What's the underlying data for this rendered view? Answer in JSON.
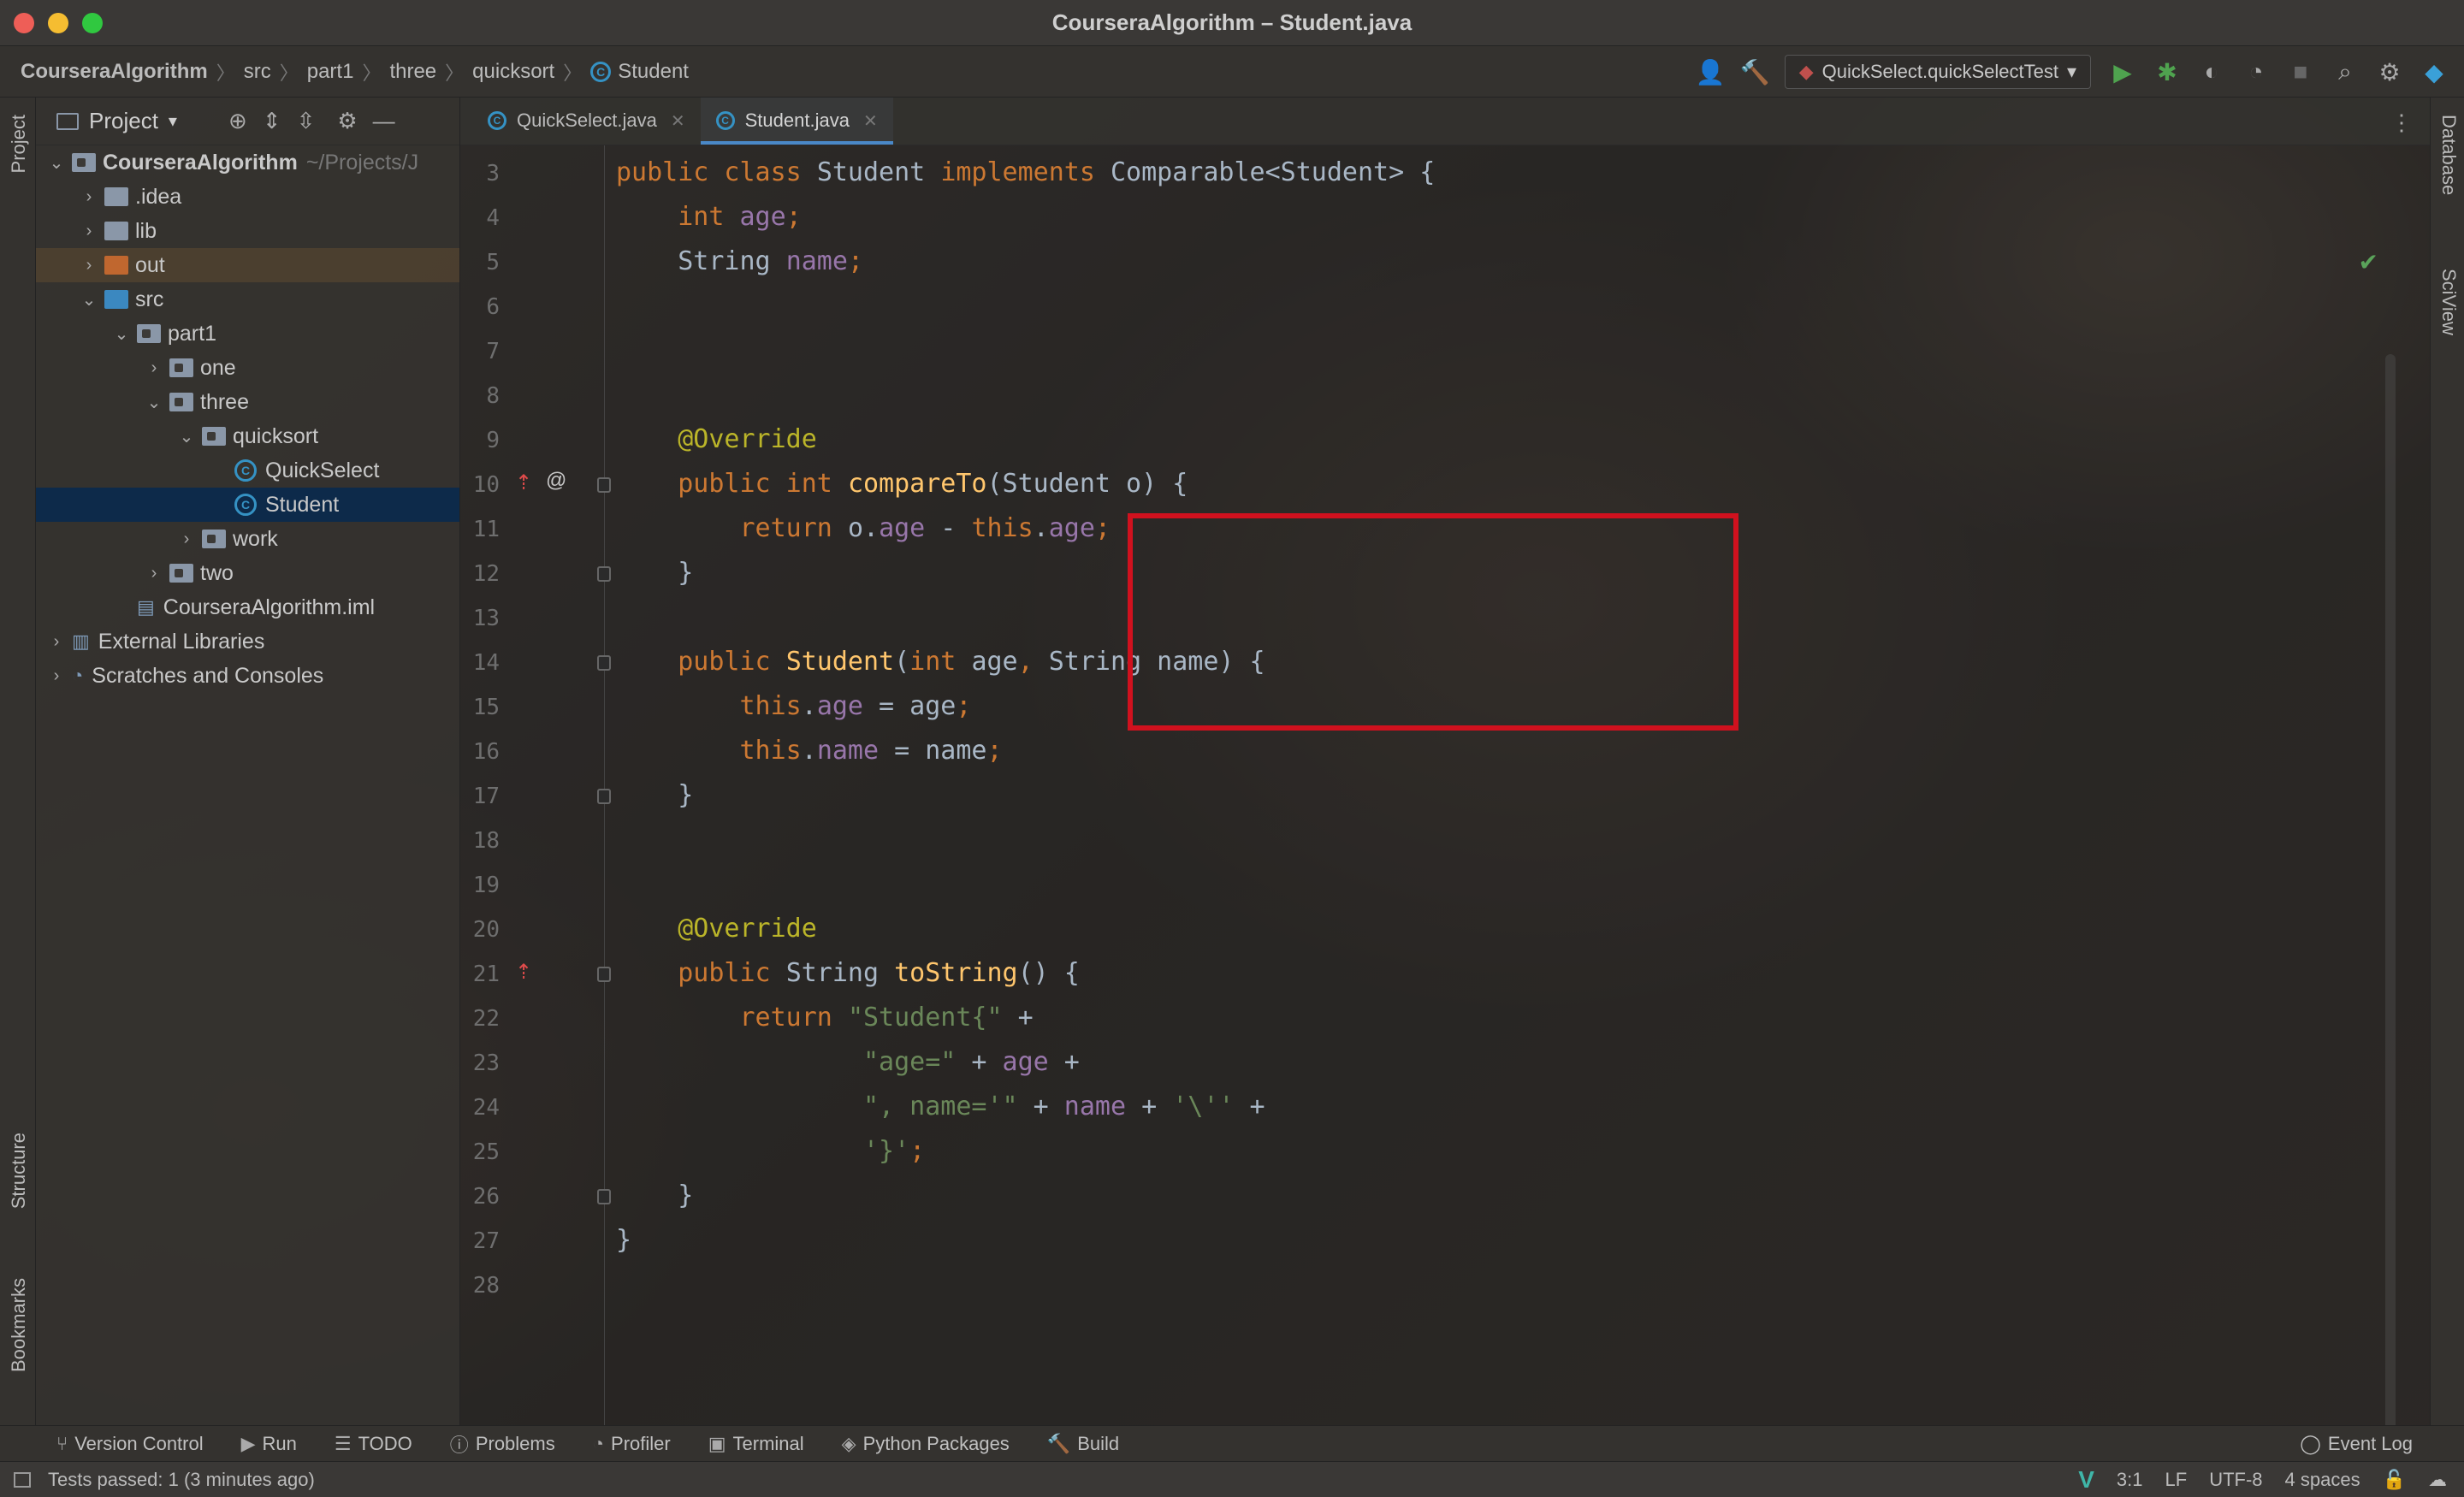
{
  "window": {
    "title": "CourseraAlgorithm – Student.java"
  },
  "breadcrumb": [
    "CourseraAlgorithm",
    "src",
    "part1",
    "three",
    "quicksort",
    "Student"
  ],
  "run_config": "QuickSelect.quickSelectTest",
  "project_panel": {
    "title": "Project",
    "tree": [
      {
        "label": "CourseraAlgorithm",
        "hint": "~/Projects/J",
        "indent": 0,
        "arrow": "down",
        "type": "module"
      },
      {
        "label": ".idea",
        "indent": 1,
        "arrow": "right",
        "type": "folder"
      },
      {
        "label": "lib",
        "indent": 1,
        "arrow": "right",
        "type": "folder"
      },
      {
        "label": "out",
        "indent": 1,
        "arrow": "right",
        "type": "folder-orange"
      },
      {
        "label": "src",
        "indent": 1,
        "arrow": "down",
        "type": "folder-blue"
      },
      {
        "label": "part1",
        "indent": 2,
        "arrow": "down",
        "type": "package"
      },
      {
        "label": "one",
        "indent": 3,
        "arrow": "right",
        "type": "package"
      },
      {
        "label": "three",
        "indent": 3,
        "arrow": "down",
        "type": "package"
      },
      {
        "label": "quicksort",
        "indent": 4,
        "arrow": "down",
        "type": "package"
      },
      {
        "label": "QuickSelect",
        "indent": 5,
        "arrow": "",
        "type": "class-runnable"
      },
      {
        "label": "Student",
        "indent": 5,
        "arrow": "",
        "type": "class",
        "selected": true
      },
      {
        "label": "work",
        "indent": 4,
        "arrow": "right",
        "type": "package"
      },
      {
        "label": "two",
        "indent": 3,
        "arrow": "right",
        "type": "package"
      },
      {
        "label": "CourseraAlgorithm.iml",
        "indent": 2,
        "arrow": "",
        "type": "iml"
      },
      {
        "label": "External Libraries",
        "indent": 0,
        "arrow": "right",
        "type": "libs"
      },
      {
        "label": "Scratches and Consoles",
        "indent": 0,
        "arrow": "right",
        "type": "scratch"
      }
    ]
  },
  "tabs": [
    {
      "label": "QuickSelect.java",
      "active": false
    },
    {
      "label": "Student.java",
      "active": true
    }
  ],
  "code_lines": [
    {
      "n": "3",
      "tokens": [
        [
          "kw",
          "public class "
        ],
        [
          "pl",
          "Student "
        ],
        [
          "kw",
          "implements "
        ],
        [
          "pl",
          "Comparable<Student> {"
        ]
      ]
    },
    {
      "n": "4",
      "tokens": [
        [
          "pl",
          "    "
        ],
        [
          "kw",
          "int "
        ],
        [
          "fd",
          "age"
        ],
        [
          "kw",
          ";"
        ]
      ]
    },
    {
      "n": "5",
      "tokens": [
        [
          "pl",
          "    String "
        ],
        [
          "fd",
          "name"
        ],
        [
          "kw",
          ";"
        ]
      ]
    },
    {
      "n": "6",
      "tokens": []
    },
    {
      "n": "7",
      "tokens": []
    },
    {
      "n": "8",
      "tokens": []
    },
    {
      "n": "9",
      "tokens": [
        [
          "pl",
          "    "
        ],
        [
          "an",
          "@Override"
        ]
      ]
    },
    {
      "n": "10",
      "tokens": [
        [
          "pl",
          "    "
        ],
        [
          "kw",
          "public int "
        ],
        [
          "fn",
          "compareTo"
        ],
        [
          "pl",
          "(Student o) {"
        ]
      ]
    },
    {
      "n": "11",
      "tokens": [
        [
          "pl",
          "        "
        ],
        [
          "kw",
          "return "
        ],
        [
          "pl",
          "o."
        ],
        [
          "fd",
          "age"
        ],
        [
          "pl",
          " - "
        ],
        [
          "kw",
          "this"
        ],
        [
          "pl",
          "."
        ],
        [
          "fd",
          "age"
        ],
        [
          "kw",
          ";"
        ]
      ]
    },
    {
      "n": "12",
      "tokens": [
        [
          "pl",
          "    }"
        ]
      ]
    },
    {
      "n": "13",
      "tokens": []
    },
    {
      "n": "14",
      "tokens": [
        [
          "pl",
          "    "
        ],
        [
          "kw",
          "public "
        ],
        [
          "fn",
          "Student"
        ],
        [
          "pl",
          "("
        ],
        [
          "kw",
          "int "
        ],
        [
          "pl",
          "age"
        ],
        [
          "kw",
          ", "
        ],
        [
          "pl",
          "String name) {"
        ]
      ]
    },
    {
      "n": "15",
      "tokens": [
        [
          "pl",
          "        "
        ],
        [
          "kw",
          "this"
        ],
        [
          "pl",
          "."
        ],
        [
          "fd",
          "age"
        ],
        [
          "pl",
          " = age"
        ],
        [
          "kw",
          ";"
        ]
      ]
    },
    {
      "n": "16",
      "tokens": [
        [
          "pl",
          "        "
        ],
        [
          "kw",
          "this"
        ],
        [
          "pl",
          "."
        ],
        [
          "fd",
          "name"
        ],
        [
          "pl",
          " = name"
        ],
        [
          "kw",
          ";"
        ]
      ]
    },
    {
      "n": "17",
      "tokens": [
        [
          "pl",
          "    }"
        ]
      ]
    },
    {
      "n": "18",
      "tokens": []
    },
    {
      "n": "19",
      "tokens": []
    },
    {
      "n": "20",
      "tokens": [
        [
          "pl",
          "    "
        ],
        [
          "an",
          "@Override"
        ]
      ]
    },
    {
      "n": "21",
      "tokens": [
        [
          "pl",
          "    "
        ],
        [
          "kw",
          "public "
        ],
        [
          "pl",
          "String "
        ],
        [
          "fn",
          "toString"
        ],
        [
          "pl",
          "() {"
        ]
      ]
    },
    {
      "n": "22",
      "tokens": [
        [
          "pl",
          "        "
        ],
        [
          "kw",
          "return "
        ],
        [
          "st",
          "\"Student{\""
        ],
        [
          "pl",
          " +"
        ]
      ]
    },
    {
      "n": "23",
      "tokens": [
        [
          "pl",
          "                "
        ],
        [
          "st",
          "\"age=\""
        ],
        [
          "pl",
          " + "
        ],
        [
          "fd",
          "age"
        ],
        [
          "pl",
          " +"
        ]
      ]
    },
    {
      "n": "24",
      "tokens": [
        [
          "pl",
          "                "
        ],
        [
          "st",
          "\", name='\""
        ],
        [
          "pl",
          " + "
        ],
        [
          "fd",
          "name"
        ],
        [
          "pl",
          " + "
        ],
        [
          "st",
          "'\\''"
        ],
        [
          "pl",
          " +"
        ]
      ]
    },
    {
      "n": "25",
      "tokens": [
        [
          "pl",
          "                "
        ],
        [
          "st",
          "'}'"
        ],
        [
          "kw",
          ";"
        ]
      ]
    },
    {
      "n": "26",
      "tokens": [
        [
          "pl",
          "    }"
        ]
      ]
    },
    {
      "n": "27",
      "tokens": [
        [
          "pl",
          "}"
        ]
      ]
    },
    {
      "n": "28",
      "tokens": []
    }
  ],
  "bottom_tools": [
    "Version Control",
    "Run",
    "TODO",
    "Problems",
    "Profiler",
    "Terminal",
    "Python Packages",
    "Build"
  ],
  "event_log": "Event Log",
  "left_strip": {
    "top": "Project",
    "structure": "Structure",
    "bookmarks": "Bookmarks"
  },
  "right_strip": {
    "database": "Database",
    "sciview": "SciView"
  },
  "status": {
    "message": "Tests passed: 1 (3 minutes ago)",
    "position": "3:1",
    "line_sep": "LF",
    "encoding": "UTF-8",
    "indent": "4 spaces"
  },
  "colors": {
    "keyword": "#cc7832",
    "annotation": "#bbb529",
    "function": "#ffc66d",
    "field": "#9876aa",
    "string": "#6a8759",
    "highlight_box": "#d0111e"
  }
}
